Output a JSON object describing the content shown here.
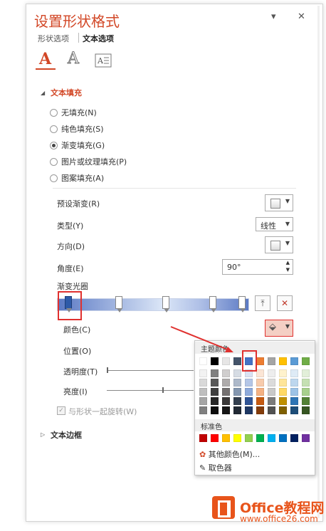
{
  "pane": {
    "title": "设置形状格式",
    "controls": {
      "dropdown": "▾",
      "close": "✕"
    },
    "tabs": [
      {
        "label": "形状选项"
      },
      {
        "label": "文本选项"
      }
    ],
    "icons": [
      "text-fill-outline-icon",
      "text-effects-icon",
      "textbox-icon"
    ]
  },
  "text_fill": {
    "header": "文本填充",
    "options": [
      {
        "label": "无填充(N)",
        "selected": false
      },
      {
        "label": "纯色填充(S)",
        "selected": false
      },
      {
        "label": "渐变填充(G)",
        "selected": true
      },
      {
        "label": "图片或纹理填充(P)",
        "selected": false
      },
      {
        "label": "图案填充(A)",
        "selected": false
      }
    ]
  },
  "gradient": {
    "preset_label": "预设渐变(R)",
    "type_label": "类型(Y)",
    "type_value": "线性",
    "direction_label": "方向(D)",
    "angle_label": "角度(E)",
    "angle_value": "90°",
    "stops_label": "渐变光圈",
    "stop_count": 5,
    "color_label": "颜色(C)",
    "position_label": "位置(O)",
    "transparency_label": "透明度(T)",
    "brightness_label": "亮度(I)",
    "rotate_with_shape": "与形状一起旋转(W)",
    "add_stop_icon": "add-gradient-stop-icon",
    "remove_stop_icon": "remove-gradient-stop-icon",
    "paint_bucket_icon": "paint-bucket-icon"
  },
  "text_border": {
    "header": "文本边框"
  },
  "color_picker": {
    "theme_header": "主题颜色",
    "standard_header": "标准色",
    "more_colors": "其他颜色(M)...",
    "eyedropper": "取色器",
    "theme_top": [
      "#ffffff",
      "#000000",
      "#e7e6e6",
      "#44546a",
      "#4472c4",
      "#ed7d31",
      "#a5a5a5",
      "#ffc000",
      "#5b9bd5",
      "#70ad47"
    ],
    "theme_shades": [
      [
        "#f2f2f2",
        "#d9d9d9",
        "#bfbfbf",
        "#a6a6a6",
        "#808080"
      ],
      [
        "#808080",
        "#595959",
        "#404040",
        "#262626",
        "#0d0d0d"
      ],
      [
        "#d0cece",
        "#aeabab",
        "#757171",
        "#3a3838",
        "#171616"
      ],
      [
        "#d6dce4",
        "#adb9ca",
        "#8497b0",
        "#333f4f",
        "#222a35"
      ],
      [
        "#d9e2f3",
        "#b4c6e7",
        "#8eaadb",
        "#2f5496",
        "#1f3864"
      ],
      [
        "#fbe5d5",
        "#f7cbac",
        "#f4b183",
        "#c55a11",
        "#833c0b"
      ],
      [
        "#ededed",
        "#dbdbdb",
        "#c9c9c9",
        "#7b7b7b",
        "#525252"
      ],
      [
        "#fff2cc",
        "#fee599",
        "#ffd965",
        "#bf9000",
        "#7f6000"
      ],
      [
        "#deebf6",
        "#bdd7ee",
        "#9dc3e6",
        "#2e75b5",
        "#1e4e79"
      ],
      [
        "#e2efd9",
        "#c5e0b3",
        "#a8d08d",
        "#538135",
        "#375623"
      ]
    ],
    "standard": [
      "#c00000",
      "#ff0000",
      "#ffc000",
      "#ffff00",
      "#92d050",
      "#00b050",
      "#00b0f0",
      "#0070c0",
      "#002060",
      "#7030a0"
    ]
  },
  "watermark": {
    "brand": "Office教程网",
    "url": "www.office26.com"
  }
}
